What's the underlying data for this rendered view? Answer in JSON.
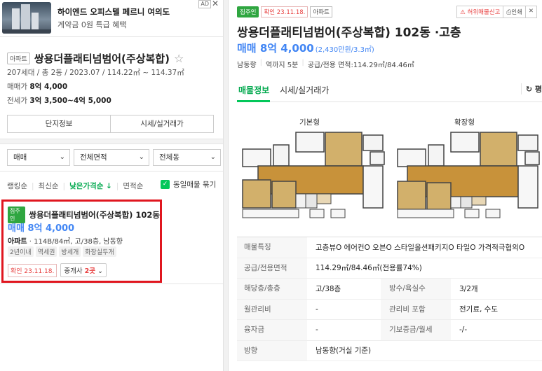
{
  "ad": {
    "title": "하이엔드 오피스텔 페르니 여의도",
    "subtitle": "계약금 0원 특급 혜택",
    "badge": "AD",
    "close": "✕"
  },
  "complex": {
    "type_tag": "아파트",
    "name": "쌍용더플래티넘범어(주상복합)",
    "info": "207세대 / 총 2동 / 2023.07 / 114.22㎡ ~ 114.37㎡",
    "sale_label": "매매가",
    "sale_value": "8억 4,000",
    "jeonse_label": "전세가",
    "jeonse_value": "3억 3,500~4억 5,000",
    "btn_info": "단지정보",
    "btn_market": "시세/실거래가"
  },
  "filters": {
    "trade": "매매",
    "area": "전체면적",
    "dong": "전체동"
  },
  "sort": {
    "items": [
      "랭킹순",
      "최신순",
      "낮은가격순 ↓",
      "면적순"
    ],
    "same_listing": "동일매물 묶기"
  },
  "listing": {
    "owner_tag": "집주인",
    "name": "쌍용더플래티넘범어(주상복합) 102동",
    "price": "매매 8억 4,000",
    "spec_type": "아파트",
    "spec_rest": " · 114B/84㎡, 고/38층, 남동향",
    "chips": [
      "2년이내",
      "역세권",
      "방세개",
      "화장실두개"
    ],
    "confirmed": "확인 23.11.18.",
    "agent_prefix": "중개사 ",
    "agent_count": "2곳"
  },
  "detail": {
    "owner_tag": "집주인",
    "confirmed": "확인 23.11.18.",
    "type_tag": "아파트",
    "report": "허위매물신고",
    "print": "인쇄",
    "title": "쌍용더플래티넘범어(주상복합) 102동 ·고층",
    "price": "매매 8억 4,000",
    "price_per": "(2,430만원/3.3㎡)",
    "meta": [
      "남동향",
      "역까지 5분",
      "공급/전용 면적:114.29㎡/84.46㎡"
    ],
    "tabs": [
      "매물정보",
      "시세/실거래가"
    ],
    "tab_right": "평",
    "plan_basic": "기본형",
    "plan_ext": "확장형",
    "rows": [
      {
        "k": "매물특징",
        "v": "고층뷰O 에어컨O 오븐O 스타일올션패키지O 타일O 가격적극협의O"
      },
      {
        "k": "공급/전용면적",
        "v": "114.29㎡/84.46㎡(전용률74%)"
      },
      {
        "k": "해당층/총층",
        "v": "고/38층",
        "k2": "방수/욕실수",
        "v2": "3/2개"
      },
      {
        "k": "월관리비",
        "v": "-",
        "k2": "관리비 포함",
        "v2": "전기료, 수도"
      },
      {
        "k": "융자금",
        "v": "-",
        "k2": "기보증금/월세",
        "v2": "-/-"
      },
      {
        "k": "방향",
        "v": "남동향(거실 기준)"
      }
    ]
  },
  "colors": {
    "accent_green": "#03c75a",
    "price_blue": "#4286f4",
    "highlight_red": "#e0161f"
  }
}
